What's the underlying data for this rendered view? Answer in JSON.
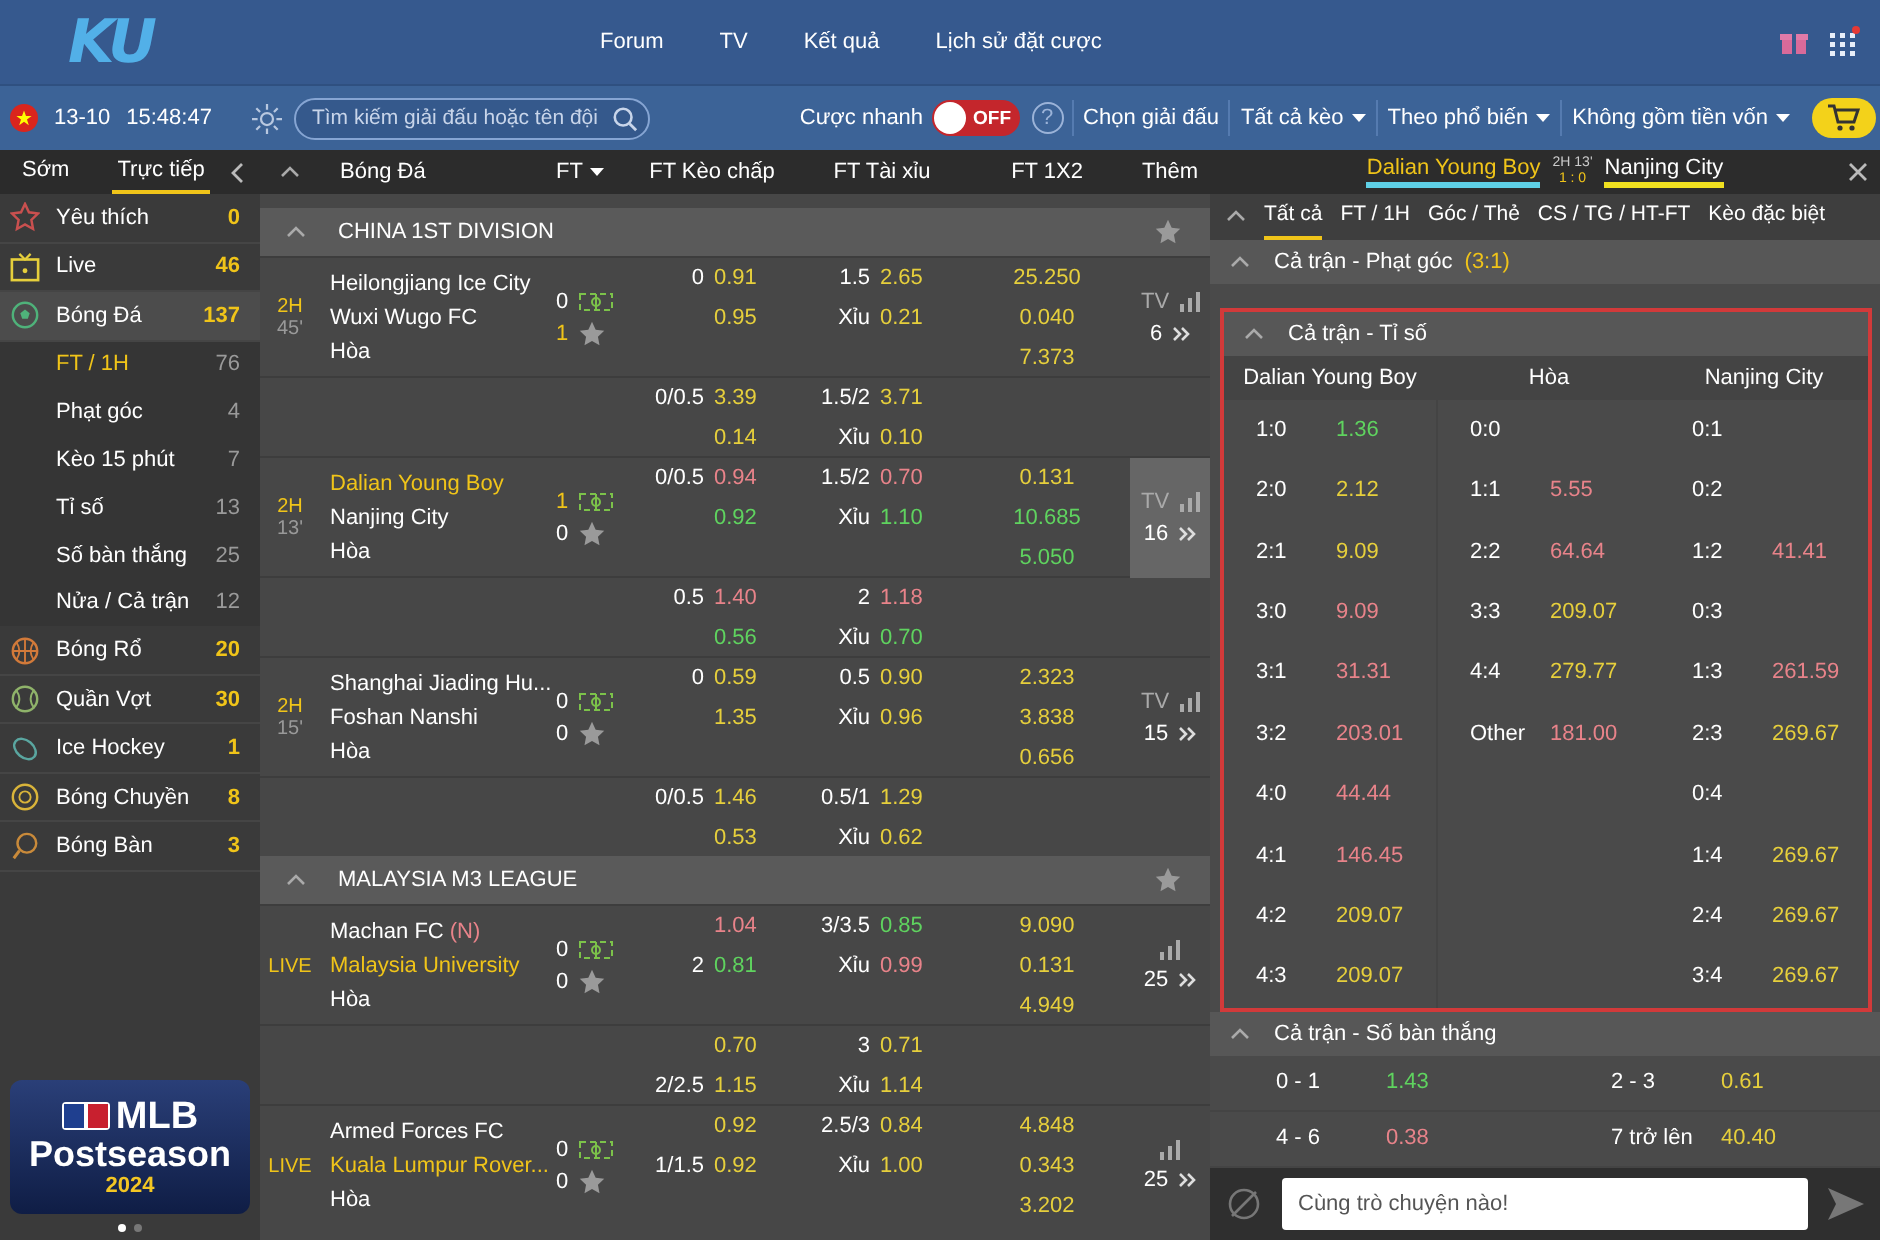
{
  "header": {
    "logo": "KU",
    "nav": [
      "Forum",
      "TV",
      "Kết quả",
      "Lịch sử đặt cược"
    ],
    "notification": true
  },
  "toolbar": {
    "date": "13-10",
    "time": "15:48:47",
    "search": {
      "placeholder": "Tìm kiếm giải đấu hoặc tên đội"
    },
    "quick_bet": {
      "label": "Cược nhanh",
      "on": false,
      "state_label": "OFF"
    },
    "help": "?",
    "filters": [
      {
        "label": "Chọn giải đấu",
        "dropdown": false
      },
      {
        "label": "Tất cả kèo",
        "dropdown": true
      },
      {
        "label": "Theo phổ biến",
        "dropdown": true
      },
      {
        "label": "Không gồm tiền vốn",
        "dropdown": true
      }
    ]
  },
  "sidebar": {
    "tabs": [
      {
        "label": "Sớm",
        "selected": false
      },
      {
        "label": "Trực tiếp",
        "selected": true
      }
    ],
    "items": [
      {
        "label": "Yêu thích",
        "count": "0",
        "selected": false
      },
      {
        "label": "Live",
        "count": "46",
        "selected": false
      },
      {
        "label": "Bóng Đá",
        "count": "137",
        "selected": true,
        "children": [
          {
            "label": "FT / 1H",
            "count": "76",
            "selected": true
          },
          {
            "label": "Phạt góc",
            "count": "4",
            "selected": false
          },
          {
            "label": "Kèo 15 phút",
            "count": "7",
            "selected": false
          },
          {
            "label": "Tỉ số",
            "count": "13",
            "selected": false
          },
          {
            "label": "Số bàn thắng",
            "count": "25",
            "selected": false
          },
          {
            "label": "Nửa / Cả trận",
            "count": "12",
            "selected": false
          }
        ]
      },
      {
        "label": "Bóng Rổ",
        "count": "20",
        "selected": false
      },
      {
        "label": "Quần Vợt",
        "count": "30",
        "selected": false
      },
      {
        "label": "Ice Hockey",
        "count": "1",
        "selected": false
      },
      {
        "label": "Bóng Chuyền",
        "count": "8",
        "selected": false
      },
      {
        "label": "Bóng Bàn",
        "count": "3",
        "selected": false
      }
    ],
    "banner": {
      "title": "MLB",
      "subtitle": "Postseason",
      "year": "2024",
      "pages": [
        {
          "selected": true
        },
        {
          "selected": false
        }
      ]
    }
  },
  "match_list": {
    "header": {
      "sport": "Bóng Đá",
      "period": "FT",
      "columns": [
        "FT Kèo chấp",
        "FT Tài xỉu",
        "FT 1X2",
        "Thêm"
      ]
    },
    "leagues": [
      {
        "name": "CHINA 1ST DIVISION",
        "matches": [
          {
            "period": "2H",
            "minute": "45'",
            "teams": [
              {
                "name": "Heilongjiang Ice City",
                "score": "0",
                "favored": false,
                "score_highlighted": false
              },
              {
                "name": "Wuxi Wugo FC",
                "score": "1",
                "favored": false,
                "score_highlighted": true
              }
            ],
            "draw": "Hòa",
            "tv_label": "TV",
            "market_count": "6",
            "selected": false,
            "lines": [
              {
                "hdp": [
                  {
                    "line": "0",
                    "odd": "0.91",
                    "up": false,
                    "down": false
                  },
                  {
                    "odd": "0.95",
                    "up": false,
                    "down": false
                  }
                ],
                "ou": [
                  {
                    "line": "1.5",
                    "odd": "2.65",
                    "up": false,
                    "down": false
                  },
                  {
                    "line": "Xỉu",
                    "odd": "0.21",
                    "up": false,
                    "down": false
                  }
                ],
                "x12": [
                  {
                    "odd": "25.250",
                    "up": false,
                    "down": false
                  },
                  {
                    "odd": "0.040",
                    "up": false,
                    "down": false
                  },
                  {
                    "odd": "7.373",
                    "up": false,
                    "down": false
                  }
                ]
              },
              {
                "hdp": [
                  {
                    "line": "0/0.5",
                    "odd": "3.39",
                    "up": false,
                    "down": false
                  },
                  {
                    "odd": "0.14",
                    "up": false,
                    "down": false
                  }
                ],
                "ou": [
                  {
                    "line": "1.5/2",
                    "odd": "3.71",
                    "up": false,
                    "down": false
                  },
                  {
                    "line": "Xỉu",
                    "odd": "0.10",
                    "up": false,
                    "down": false
                  }
                ]
              }
            ]
          },
          {
            "period": "2H",
            "minute": "13'",
            "teams": [
              {
                "name": "Dalian Young Boy",
                "score": "1",
                "favored": true,
                "score_highlighted": true
              },
              {
                "name": "Nanjing City",
                "score": "0",
                "favored": false,
                "score_highlighted": false
              }
            ],
            "draw": "Hòa",
            "tv_label": "TV",
            "market_count": "16",
            "selected": true,
            "lines": [
              {
                "hdp": [
                  {
                    "line": "0/0.5",
                    "odd": "0.94",
                    "up": false,
                    "down": true
                  },
                  {
                    "odd": "0.92",
                    "up": true,
                    "down": false
                  }
                ],
                "ou": [
                  {
                    "line": "1.5/2",
                    "odd": "0.70",
                    "up": false,
                    "down": true
                  },
                  {
                    "line": "Xỉu",
                    "odd": "1.10",
                    "up": true,
                    "down": false
                  }
                ],
                "x12": [
                  {
                    "odd": "0.131",
                    "up": false,
                    "down": false
                  },
                  {
                    "odd": "10.685",
                    "up": true,
                    "down": false
                  },
                  {
                    "odd": "5.050",
                    "up": true,
                    "down": false
                  }
                ]
              },
              {
                "hdp": [
                  {
                    "line": "0.5",
                    "odd": "1.40",
                    "up": false,
                    "down": true
                  },
                  {
                    "odd": "0.56",
                    "up": true,
                    "down": false
                  }
                ],
                "ou": [
                  {
                    "line": "2",
                    "odd": "1.18",
                    "up": false,
                    "down": true
                  },
                  {
                    "line": "Xỉu",
                    "odd": "0.70",
                    "up": true,
                    "down": false
                  }
                ]
              }
            ]
          },
          {
            "period": "2H",
            "minute": "15'",
            "teams": [
              {
                "name": "Shanghai Jiading Hu...",
                "score": "0",
                "favored": false,
                "score_highlighted": false
              },
              {
                "name": "Foshan Nanshi",
                "score": "0",
                "favored": false,
                "score_highlighted": false
              }
            ],
            "draw": "Hòa",
            "tv_label": "TV",
            "market_count": "15",
            "selected": false,
            "lines": [
              {
                "hdp": [
                  {
                    "line": "0",
                    "odd": "0.59",
                    "up": false,
                    "down": false
                  },
                  {
                    "odd": "1.35",
                    "up": false,
                    "down": false
                  }
                ],
                "ou": [
                  {
                    "line": "0.5",
                    "odd": "0.90",
                    "up": false,
                    "down": false
                  },
                  {
                    "line": "Xỉu",
                    "odd": "0.96",
                    "up": false,
                    "down": false
                  }
                ],
                "x12": [
                  {
                    "odd": "2.323",
                    "up": false,
                    "down": false
                  },
                  {
                    "odd": "3.838",
                    "up": false,
                    "down": false
                  },
                  {
                    "odd": "0.656",
                    "up": false,
                    "down": false
                  }
                ]
              },
              {
                "hdp": [
                  {
                    "line": "0/0.5",
                    "odd": "1.46",
                    "up": false,
                    "down": false
                  },
                  {
                    "odd": "0.53",
                    "up": false,
                    "down": false
                  }
                ],
                "ou": [
                  {
                    "line": "0.5/1",
                    "odd": "1.29",
                    "up": false,
                    "down": false
                  },
                  {
                    "line": "Xỉu",
                    "odd": "0.62",
                    "up": false,
                    "down": false
                  }
                ]
              }
            ]
          }
        ]
      },
      {
        "name": "MALAYSIA M3 LEAGUE",
        "matches": [
          {
            "period": "LIVE",
            "teams": [
              {
                "name": "Machan FC",
                "tag": "(N)",
                "score": "0",
                "favored": false,
                "score_highlighted": false
              },
              {
                "name": "Malaysia University",
                "score": "0",
                "favored": true,
                "score_highlighted": false
              }
            ],
            "draw": "Hòa",
            "market_count": "25",
            "selected": false,
            "lines": [
              {
                "hdp": [
                  {
                    "odd": "1.04",
                    "up": false,
                    "down": true
                  },
                  {
                    "line": "2",
                    "odd": "0.81",
                    "up": true,
                    "down": false
                  }
                ],
                "ou": [
                  {
                    "line": "3/3.5",
                    "odd": "0.85",
                    "up": true,
                    "down": false
                  },
                  {
                    "line": "Xỉu",
                    "odd": "0.99",
                    "up": false,
                    "down": true
                  }
                ],
                "x12": [
                  {
                    "odd": "9.090",
                    "up": false,
                    "down": false
                  },
                  {
                    "odd": "0.131",
                    "up": false,
                    "down": false
                  },
                  {
                    "odd": "4.949",
                    "up": false,
                    "down": false
                  }
                ]
              },
              {
                "hdp": [
                  {
                    "odd": "0.70",
                    "up": false,
                    "down": false
                  },
                  {
                    "line": "2/2.5",
                    "odd": "1.15",
                    "up": false,
                    "down": false
                  }
                ],
                "ou": [
                  {
                    "line": "3",
                    "odd": "0.71",
                    "up": false,
                    "down": false
                  },
                  {
                    "line": "Xỉu",
                    "odd": "1.14",
                    "up": false,
                    "down": false
                  }
                ]
              }
            ]
          },
          {
            "period": "LIVE",
            "teams": [
              {
                "name": "Armed Forces FC",
                "score": "0",
                "favored": false,
                "score_highlighted": false
              },
              {
                "name": "Kuala Lumpur Rover...",
                "score": "0",
                "favored": true,
                "score_highlighted": false
              }
            ],
            "draw": "Hòa",
            "market_count": "25",
            "selected": false,
            "lines": [
              {
                "hdp": [
                  {
                    "odd": "0.92",
                    "up": false,
                    "down": false
                  },
                  {
                    "line": "1/1.5",
                    "odd": "0.92",
                    "up": false,
                    "down": false
                  }
                ],
                "ou": [
                  {
                    "line": "2.5/3",
                    "odd": "0.84",
                    "up": false,
                    "down": false
                  },
                  {
                    "line": "Xỉu",
                    "odd": "1.00",
                    "up": false,
                    "down": false
                  }
                ],
                "x12": [
                  {
                    "odd": "4.848",
                    "up": false,
                    "down": false
                  },
                  {
                    "odd": "0.343",
                    "up": false,
                    "down": false
                  },
                  {
                    "odd": "3.202",
                    "up": false,
                    "down": false
                  }
                ]
              }
            ]
          }
        ]
      }
    ]
  },
  "match_detail": {
    "home": {
      "name": "Dalian Young Boy",
      "color": "#5fd0e6"
    },
    "status": "2H 13'",
    "score": "1 : 0",
    "away": {
      "name": "Nanjing City",
      "color": "#f0e020"
    },
    "tabs": [
      {
        "label": "Tất cả",
        "selected": true
      },
      {
        "label": "FT / 1H",
        "selected": false
      },
      {
        "label": "Góc / Thẻ",
        "selected": false
      },
      {
        "label": "CS / TG / HT-FT",
        "selected": false
      },
      {
        "label": "Kèo đặc biệt",
        "selected": false
      }
    ],
    "sections": [
      {
        "kind": "header",
        "title": "Cả trận - Phạt góc",
        "note": "(3:1)",
        "highlighted": false
      },
      {
        "kind": "correct_score",
        "title": "Cả trận - Tỉ số",
        "highlighted": true,
        "columns": [
          {
            "header": "Dalian Young Boy",
            "rows": [
              {
                "score": "1:0",
                "odd": "1.36",
                "up": true,
                "down": false
              },
              {
                "score": "2:0",
                "odd": "2.12",
                "up": false,
                "down": false
              },
              {
                "score": "2:1",
                "odd": "9.09",
                "up": false,
                "down": false
              },
              {
                "score": "3:0",
                "odd": "9.09",
                "up": false,
                "down": true
              },
              {
                "score": "3:1",
                "odd": "31.31",
                "up": false,
                "down": true
              },
              {
                "score": "3:2",
                "odd": "203.01",
                "up": false,
                "down": true
              },
              {
                "score": "4:0",
                "odd": "44.44",
                "up": false,
                "down": true
              },
              {
                "score": "4:1",
                "odd": "146.45",
                "up": false,
                "down": true
              },
              {
                "score": "4:2",
                "odd": "209.07",
                "up": false,
                "down": false
              },
              {
                "score": "4:3",
                "odd": "209.07",
                "up": false,
                "down": false
              }
            ]
          },
          {
            "header": "Hòa",
            "rows": [
              {
                "score": "0:0"
              },
              {
                "score": "1:1",
                "odd": "5.55",
                "up": false,
                "down": true
              },
              {
                "score": "2:2",
                "odd": "64.64",
                "up": false,
                "down": true
              },
              {
                "score": "3:3",
                "odd": "209.07",
                "up": false,
                "down": false
              },
              {
                "score": "4:4",
                "odd": "279.77",
                "up": false,
                "down": false
              },
              {
                "score": "Other",
                "odd": "181.00",
                "up": false,
                "down": true
              }
            ]
          },
          {
            "header": "Nanjing City",
            "rows": [
              {
                "score": "0:1"
              },
              {
                "score": "0:2"
              },
              {
                "score": "1:2",
                "odd": "41.41",
                "up": false,
                "down": true
              },
              {
                "score": "0:3"
              },
              {
                "score": "1:3",
                "odd": "261.59",
                "up": false,
                "down": true
              },
              {
                "score": "2:3",
                "odd": "269.67",
                "up": false,
                "down": false
              },
              {
                "score": "0:4"
              },
              {
                "score": "1:4",
                "odd": "269.67",
                "up": false,
                "down": false
              },
              {
                "score": "2:4",
                "odd": "269.67",
                "up": false,
                "down": false
              },
              {
                "score": "3:4",
                "odd": "269.67",
                "up": false,
                "down": false
              }
            ]
          }
        ]
      },
      {
        "kind": "total_goals",
        "title": "Cả trận - Số bàn thắng",
        "highlighted": false,
        "rows": [
          [
            {
              "label": "0 - 1",
              "odd": "1.43",
              "up": true,
              "down": false
            },
            {
              "label": "2 - 3",
              "odd": "0.61",
              "up": false,
              "down": false
            }
          ],
          [
            {
              "label": "4 - 6",
              "odd": "0.38",
              "up": false,
              "down": true
            },
            {
              "label": "7 trở lên",
              "odd": "40.40",
              "up": false,
              "down": false
            }
          ]
        ]
      }
    ]
  },
  "chat": {
    "placeholder": "Cùng trò chuyện nào!"
  }
}
